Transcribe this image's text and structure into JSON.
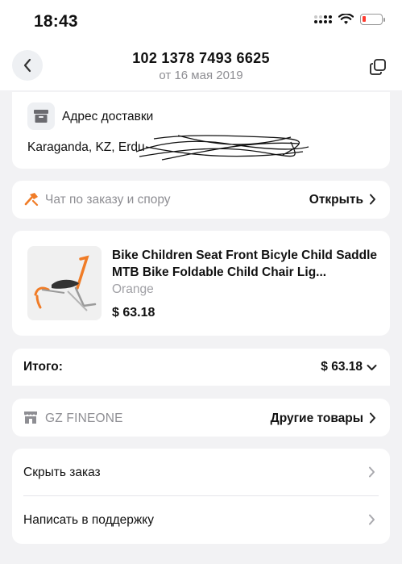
{
  "status_bar": {
    "time": "18:43"
  },
  "header": {
    "order_number": "102 1378 7493 6625",
    "order_date": "от 16 мая 2019"
  },
  "address": {
    "title": "Адрес доставки",
    "line": "Karaganda, KZ, Erdu"
  },
  "chat": {
    "label": "Чат по заказу и спору",
    "action": "Открыть"
  },
  "product": {
    "title": "Bike Children Seat Front Bicyle Child Saddle MTB Bike Foldable Child Chair Lig...",
    "variant": "Orange",
    "price": "$ 63.18"
  },
  "total": {
    "label": "Итого:",
    "value": "$ 63.18"
  },
  "store": {
    "name": "GZ FINEONE",
    "action": "Другие товары"
  },
  "menu": {
    "items": [
      {
        "label": "Скрыть заказ"
      },
      {
        "label": "Написать в поддержку"
      }
    ]
  },
  "colors": {
    "accent": "#f07c27",
    "background": "#f2f2f4",
    "muted": "#8e8e93",
    "battery_low": "#ff3b30"
  }
}
